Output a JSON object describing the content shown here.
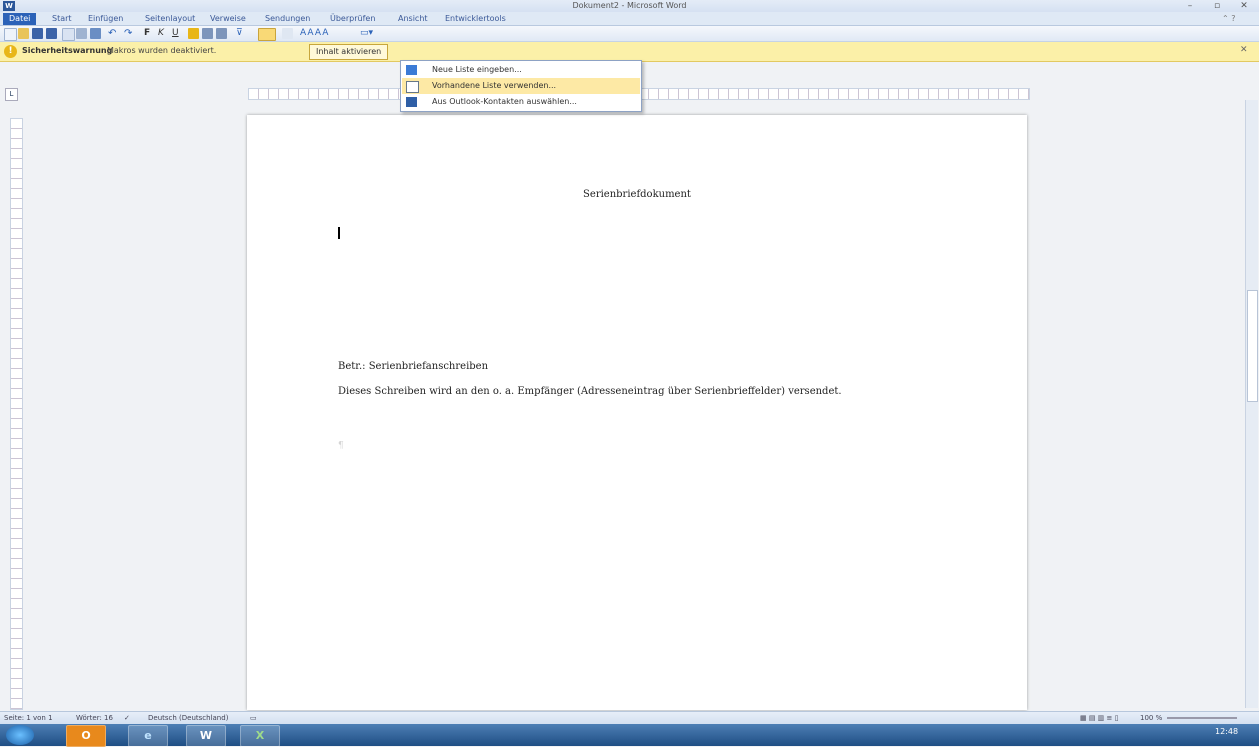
{
  "window": {
    "title": "Dokument2 - Microsoft Word",
    "app_icon": "W"
  },
  "tabs": [
    "Datei",
    "Start",
    "Einfügen",
    "Seitenlayout",
    "Verweise",
    "Sendungen",
    "Überprüfen",
    "Ansicht",
    "Entwicklertools"
  ],
  "security_bar": {
    "title": "Sicherheitswarnung",
    "message": "Makros wurden deaktiviert.",
    "button": "Inhalt aktivieren"
  },
  "menu": {
    "items": [
      {
        "label": "Neue Liste eingeben...",
        "icon": "new-list-icon"
      },
      {
        "label": "Vorhandene Liste verwenden...",
        "icon": "existing-list-icon"
      },
      {
        "label": "Aus Outlook-Kontakten auswählen...",
        "icon": "outlook-contacts-icon"
      }
    ]
  },
  "document": {
    "title": "Serienbriefdokument",
    "betr": "Betr.: Serienbriefanschreiben",
    "body": "Dieses Schreiben wird an den o. a. Empfänger (Adresseneintrag über Serienbrieffelder) versendet."
  },
  "status": {
    "page": "Seite: 1 von 1",
    "words": "Wörter: 16",
    "language": "Deutsch (Deutschland)",
    "zoom": "100 %"
  },
  "taskbar": {
    "clock": "12:48"
  },
  "colors": {
    "accent": "#2b62b8",
    "warning": "#fbf0a8",
    "menu_hover": "#fde9a5"
  }
}
